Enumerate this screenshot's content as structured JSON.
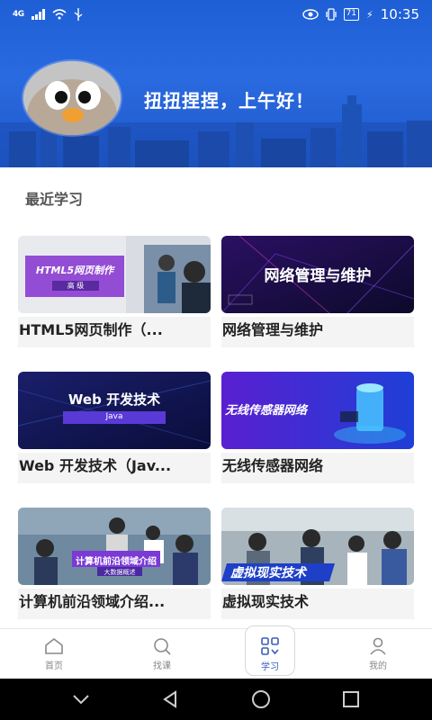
{
  "status": {
    "network": "4G",
    "battery": "71",
    "time": "10:35"
  },
  "header": {
    "greeting": "扭扭捏捏，上午好！"
  },
  "recent": {
    "title": "最近学习",
    "courses": [
      {
        "title": "HTML5网页制作（...",
        "thumb_text": "HTML5网页制作",
        "thumb_sub": "高 级"
      },
      {
        "title": "网络管理与维护",
        "thumb_text": "网络管理与维护",
        "thumb_sub": ""
      },
      {
        "title": "Web 开发技术（Jav...",
        "thumb_text": "Web 开发技术",
        "thumb_sub": "Java"
      },
      {
        "title": "无线传感器网络",
        "thumb_text": "无线传感器网络",
        "thumb_sub": ""
      },
      {
        "title": "计算机前沿领域介绍...",
        "thumb_text": "计算机前沿领域介绍",
        "thumb_sub": "大数据概述"
      },
      {
        "title": "虚拟现实技术",
        "thumb_text": "虚拟现实技术",
        "thumb_sub": ""
      }
    ]
  },
  "nav": {
    "items": [
      {
        "label": "首页",
        "icon": "home-icon"
      },
      {
        "label": "找课",
        "icon": "search-icon"
      },
      {
        "label": "学习",
        "icon": "grid-icon"
      },
      {
        "label": "我的",
        "icon": "user-icon"
      }
    ],
    "active_color": "#3b5bb8"
  }
}
